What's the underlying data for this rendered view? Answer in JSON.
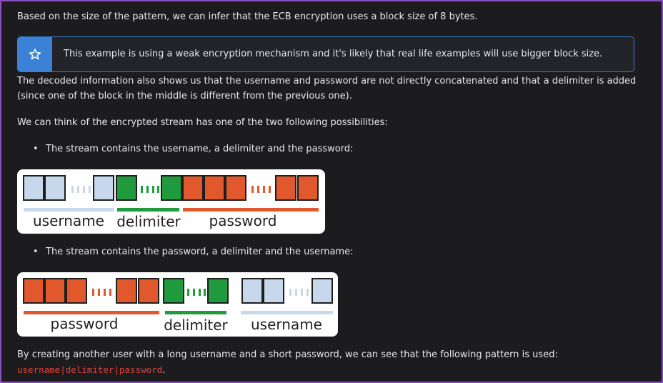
{
  "intro": "Based on the size of the pattern, we can infer that the ECB encryption uses a block size of 8 bytes.",
  "note": {
    "icon": "star-icon",
    "text": "This example is using a weak encryption mechanism and it's likely that real life examples will use bigger block size."
  },
  "para_decoded": "The decoded information also shows us that the username and password are not directly concatenated and that a delimiter is added (since one of the block in the middle is different from the previous one).",
  "para_possibilities": "We can think of the encrypted stream has one of the two following possibilities:",
  "bullets": [
    "The stream contains the username, a delimiter and the password:",
    "The stream contains the password, a delimiter and the username:"
  ],
  "diagram1": {
    "labels": [
      "username",
      "delimiter",
      "password"
    ]
  },
  "diagram2": {
    "labels": [
      "password",
      "delimiter",
      "username"
    ]
  },
  "colors": {
    "username": "#c8d8ec",
    "delimiter": "#1f9a3c",
    "password": "#e0582b",
    "accent": "#3b82d6",
    "code": "#e0433a"
  },
  "conclusion": {
    "text": "By creating another user with a long username and a short password, we can see that the following pattern is used:",
    "code": "username|delimiter|password",
    "end": "."
  }
}
